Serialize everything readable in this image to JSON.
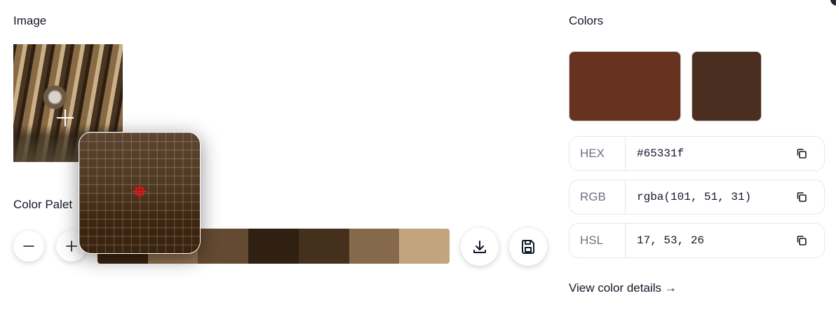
{
  "image_section": {
    "title": "Image"
  },
  "palette_section": {
    "title": "Color Palet",
    "swatches": [
      "#3a2410",
      "#8f7050",
      "#654a32",
      "#2f2012",
      "#45301e",
      "#86694a",
      "#c2a47d"
    ]
  },
  "colors_section": {
    "title": "Colors",
    "primary_color": "#65331f",
    "secondary_color": "#4a2e1f",
    "rows": [
      {
        "label": "HEX",
        "value": "#65331f"
      },
      {
        "label": "RGB",
        "value": "rgba(101, 51, 31)"
      },
      {
        "label": "HSL",
        "value": "17, 53, 26"
      }
    ],
    "details_link": "View color details →"
  },
  "icons": {
    "zoom_out": "minus-icon",
    "zoom_in": "plus-icon",
    "download": "download-icon",
    "save": "save-icon",
    "copy": "copy-icon"
  }
}
